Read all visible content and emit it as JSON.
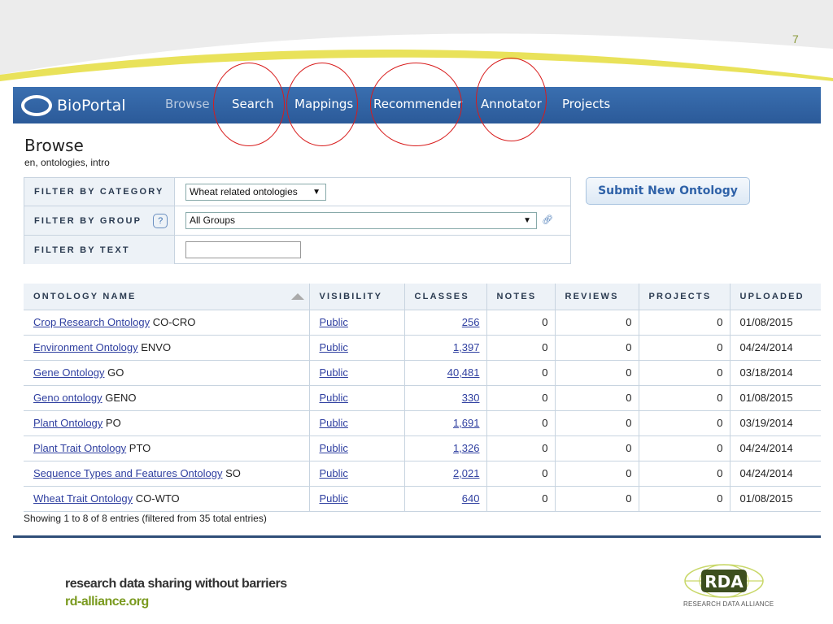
{
  "slide": {
    "number": "7"
  },
  "nav": {
    "logo": "BioPortal",
    "items": [
      {
        "label": "Browse",
        "active": true
      },
      {
        "label": "Search"
      },
      {
        "label": "Mappings"
      },
      {
        "label": "Recommender"
      },
      {
        "label": "Annotator"
      },
      {
        "label": "Projects"
      }
    ]
  },
  "page": {
    "title": "Browse",
    "subtitle": "en, ontologies, intro"
  },
  "filters": {
    "category_label": "FILTER BY CATEGORY",
    "category_value": "Wheat related ontologies",
    "group_label": "FILTER BY GROUP",
    "group_help": "?",
    "group_value": "All Groups",
    "text_label": "FILTER BY TEXT",
    "text_value": ""
  },
  "submit_button": "Submit New Ontology",
  "table": {
    "headers": [
      "ONTOLOGY NAME",
      "VISIBILITY",
      "CLASSES",
      "NOTES",
      "REVIEWS",
      "PROJECTS",
      "UPLOADED"
    ],
    "rows": [
      {
        "name": "Crop Research Ontology",
        "acronym": "CO-CRO",
        "visibility": "Public",
        "classes": "256",
        "notes": "0",
        "reviews": "0",
        "projects": "0",
        "uploaded": "01/08/2015"
      },
      {
        "name": "Environment Ontology",
        "acronym": "ENVO",
        "visibility": "Public",
        "classes": "1,397",
        "notes": "0",
        "reviews": "0",
        "projects": "0",
        "uploaded": "04/24/2014"
      },
      {
        "name": "Gene Ontology",
        "acronym": "GO",
        "visibility": "Public",
        "classes": "40,481",
        "notes": "0",
        "reviews": "0",
        "projects": "0",
        "uploaded": "03/18/2014"
      },
      {
        "name": "Geno ontology",
        "acronym": "GENO",
        "visibility": "Public",
        "classes": "330",
        "notes": "0",
        "reviews": "0",
        "projects": "0",
        "uploaded": "01/08/2015"
      },
      {
        "name": "Plant Ontology",
        "acronym": "PO",
        "visibility": "Public",
        "classes": "1,691",
        "notes": "0",
        "reviews": "0",
        "projects": "0",
        "uploaded": "03/19/2014"
      },
      {
        "name": "Plant Trait Ontology",
        "acronym": "PTO",
        "visibility": "Public",
        "classes": "1,326",
        "notes": "0",
        "reviews": "0",
        "projects": "0",
        "uploaded": "04/24/2014"
      },
      {
        "name": "Sequence Types and Features Ontology",
        "acronym": "SO",
        "visibility": "Public",
        "classes": "2,021",
        "notes": "0",
        "reviews": "0",
        "projects": "0",
        "uploaded": "04/24/2014"
      },
      {
        "name": "Wheat Trait Ontology",
        "acronym": "CO-WTO",
        "visibility": "Public",
        "classes": "640",
        "notes": "0",
        "reviews": "0",
        "projects": "0",
        "uploaded": "01/08/2015"
      }
    ],
    "summary": "Showing 1 to 8 of 8 entries (filtered from 35 total entries)"
  },
  "footer": {
    "tagline": "research data sharing without barriers",
    "url": "rd-alliance.org",
    "logo_text": "RDA",
    "logo_caption": "RESEARCH DATA ALLIANCE"
  },
  "colors": {
    "nav_blue": "#2b5a99",
    "link": "#2f3fa0",
    "annotation_red": "#d81c1c",
    "rda_green": "#7a9a1f"
  }
}
